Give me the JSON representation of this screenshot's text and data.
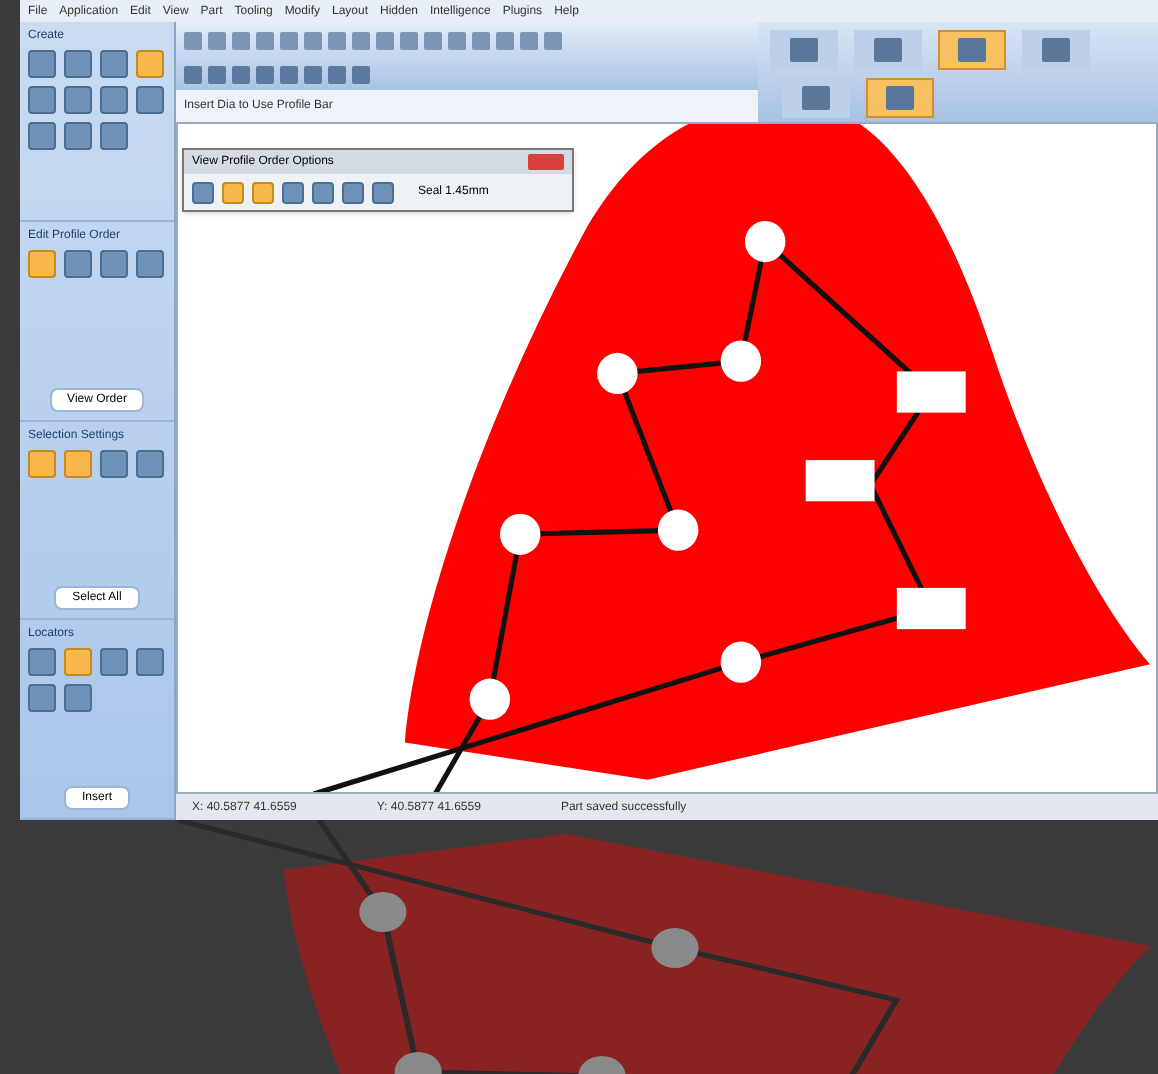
{
  "menu": [
    "File",
    "Application",
    "Edit",
    "View",
    "Part",
    "Tooling",
    "Modify",
    "Layout",
    "Hidden",
    "Intelligence",
    "Plugins",
    "Help"
  ],
  "left_panel": [
    {
      "title": "Create",
      "tools": [
        {
          "selected": false
        },
        {
          "selected": false
        },
        {
          "selected": false
        },
        {
          "selected": true
        },
        {
          "selected": false
        },
        {
          "selected": false
        },
        {
          "selected": false
        },
        {
          "selected": false
        },
        {
          "selected": false
        },
        {
          "selected": false
        },
        {
          "selected": false
        }
      ]
    },
    {
      "title": "Edit Profile Order",
      "tools": [
        {
          "selected": true
        },
        {
          "selected": false
        },
        {
          "selected": false
        },
        {
          "selected": false
        }
      ],
      "button": "View Order"
    },
    {
      "title": "Selection Settings",
      "tools": [
        {
          "selected": true
        },
        {
          "selected": true
        },
        {
          "selected": false
        },
        {
          "selected": false
        }
      ],
      "button": "Select All"
    },
    {
      "title": "Locators",
      "tools": [
        {
          "selected": false
        },
        {
          "selected": true
        },
        {
          "selected": false
        },
        {
          "selected": false
        },
        {
          "selected": false
        },
        {
          "selected": false
        }
      ],
      "button": "Insert"
    }
  ],
  "toolbar_hint": "Insert Dia to Use Profile Bar",
  "ribbon": [
    [
      {
        "selected": false
      },
      {
        "selected": false
      },
      {
        "selected": true
      },
      {
        "selected": false
      }
    ],
    [
      {
        "selected": false
      },
      {
        "selected": true
      }
    ]
  ],
  "dialog": {
    "title": "View Profile Order Options",
    "tools": [
      {
        "selected": false
      },
      {
        "selected": true
      },
      {
        "selected": true
      },
      {
        "selected": false
      },
      {
        "selected": false
      },
      {
        "selected": false
      },
      {
        "selected": false
      }
    ],
    "reading": "Seal 1.45mm"
  },
  "status_bar": [
    "X: 40.5877  41.6559",
    "Y: 40.5877  41.6559",
    "Part saved successfully"
  ]
}
